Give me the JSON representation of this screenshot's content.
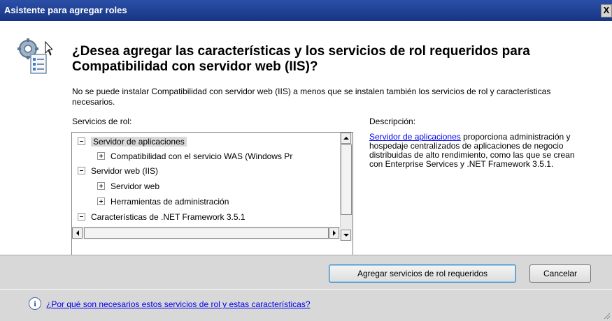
{
  "window": {
    "title": "Asistente para agregar roles",
    "close_glyph": "X"
  },
  "heading": "¿Desea agregar las características y los servicios de rol requeridos para Compatibilidad con servidor web (IIS)?",
  "intro": "No se puede instalar Compatibilidad con servidor web (IIS) a menos que se instalen también los servicios de rol y características necesarios.",
  "services_label": "Servicios de rol:",
  "description_label": "Descripción:",
  "tree": {
    "items": [
      {
        "label": "Servidor de aplicaciones",
        "expander": "minus",
        "level": 0,
        "selected": true
      },
      {
        "label": "Compatibilidad con el servicio WAS (Windows Pr",
        "expander": "plus",
        "level": 1,
        "selected": false
      },
      {
        "label": "Servidor web (IIS)",
        "expander": "minus",
        "level": 0,
        "selected": false
      },
      {
        "label": "Servidor web",
        "expander": "plus",
        "level": 1,
        "selected": false
      },
      {
        "label": "Herramientas de administración",
        "expander": "plus",
        "level": 1,
        "selected": false
      },
      {
        "label": "Características de .NET Framework 3.5.1",
        "expander": "minus",
        "level": 0,
        "selected": false
      }
    ]
  },
  "description": {
    "link_text": "Servidor de aplicaciones",
    "text": " proporciona administración y hospedaje centralizados de aplicaciones de negocio distribuidas de alto rendimiento, como las que se crean con Enterprise Services y .NET Framework 3.5.1."
  },
  "buttons": {
    "add_label": "Agregar servicios de rol requeridos",
    "cancel_label": "Cancelar"
  },
  "footer": {
    "info_glyph": "i",
    "help_link": "¿Por qué son necesarios estos servicios de rol y estas características?"
  },
  "icons": [
    "roles-wizard-icon",
    "close-icon",
    "info-icon",
    "resize-grip-icon"
  ],
  "colors": {
    "titlebar": "#183583",
    "link": "#0000ee",
    "footer": "#d8d8d8"
  }
}
